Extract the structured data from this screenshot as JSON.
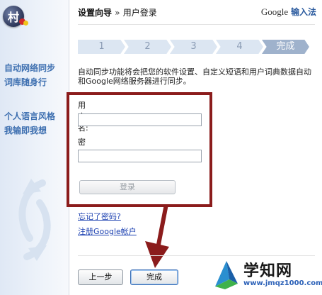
{
  "sidebar": {
    "logo_char": "村",
    "feature_1": [
      "自动网络同步",
      "词库随身行"
    ],
    "feature_2": [
      "个人语言风格",
      "我输即我想"
    ]
  },
  "header": {
    "title": "设置向导",
    "separator": "»",
    "subtitle": "用户登录",
    "brand_google": "Google",
    "brand_ime": "输入法"
  },
  "steps": [
    {
      "label": "1",
      "active": false
    },
    {
      "label": "2",
      "active": false
    },
    {
      "label": "3",
      "active": false
    },
    {
      "label": "4",
      "active": false
    },
    {
      "label": "完成",
      "active": true
    }
  ],
  "intro_text": "自动同步功能将会把您的软件设置、自定义短语和用户词典数据自动和Google网络服务器进行同步。",
  "form": {
    "username_label": "用户名:",
    "username_value": "",
    "password_label": "密　码:",
    "password_value": "",
    "login_button": "登录"
  },
  "links": {
    "forgot": "忘记了密码?",
    "register": "注册Google帐户"
  },
  "footer": {
    "back_button": "上一步",
    "finish_button": "完成"
  },
  "watermark": {
    "title": "学知网",
    "url": "www.jmqz1000.com"
  },
  "colors": {
    "highlight": "#8b1c1c",
    "link": "#1a3fb0",
    "sidebar_text": "#3d6fb0",
    "step_active": "#9fb2cc"
  }
}
